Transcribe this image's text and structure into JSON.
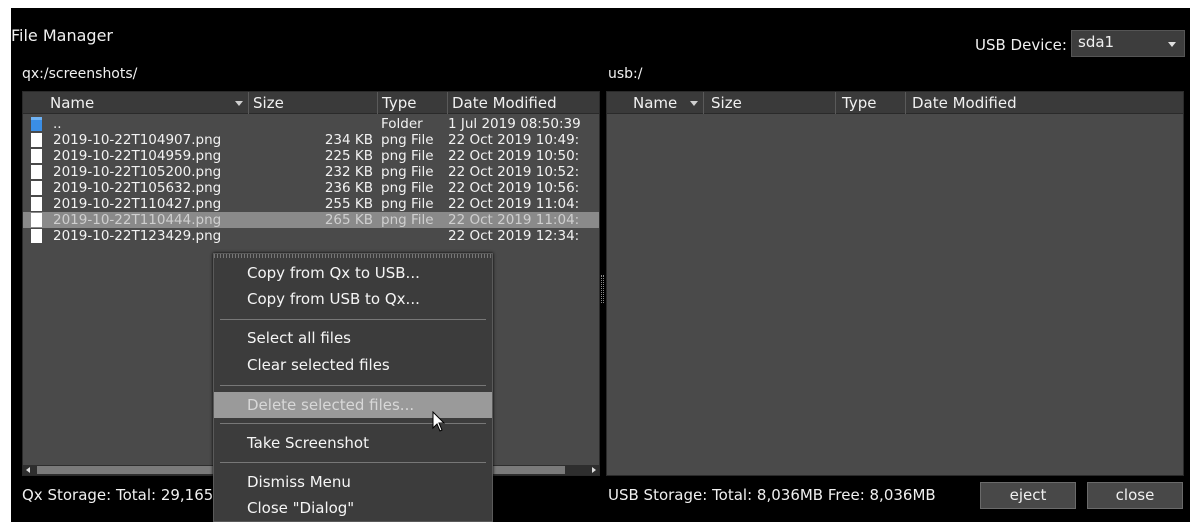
{
  "window": {
    "title": "File Manager",
    "usb_device_label": "USB Device:",
    "usb_device_value": "sda1"
  },
  "left_panel": {
    "path": "qx:/screenshots/",
    "columns": {
      "name": "Name",
      "size": "Size",
      "type": "Type",
      "date": "Date Modified"
    },
    "rows": [
      {
        "name": "..",
        "size": "",
        "type": "Folder",
        "date": "1 Jul 2019 08:50:39",
        "icon": "folder-icon",
        "selected": false
      },
      {
        "name": "2019-10-22T104907.png",
        "size": "234 KB",
        "type": "png File",
        "date": "22 Oct 2019 10:49:",
        "icon": "file-icon",
        "selected": false
      },
      {
        "name": "2019-10-22T104959.png",
        "size": "225 KB",
        "type": "png File",
        "date": "22 Oct 2019 10:50:",
        "icon": "file-icon",
        "selected": false
      },
      {
        "name": "2019-10-22T105200.png",
        "size": "232 KB",
        "type": "png File",
        "date": "22 Oct 2019 10:52:",
        "icon": "file-icon",
        "selected": false
      },
      {
        "name": "2019-10-22T105632.png",
        "size": "236 KB",
        "type": "png File",
        "date": "22 Oct 2019 10:56:",
        "icon": "file-icon",
        "selected": false
      },
      {
        "name": "2019-10-22T110427.png",
        "size": "255 KB",
        "type": "png File",
        "date": "22 Oct 2019 11:04:",
        "icon": "file-icon",
        "selected": false
      },
      {
        "name": "2019-10-22T110444.png",
        "size": "265 KB",
        "type": "png File",
        "date": "22 Oct 2019 11:04:",
        "icon": "file-icon",
        "selected": true
      },
      {
        "name": "2019-10-22T123429.png",
        "size": "",
        "type": "",
        "date": "22 Oct 2019 12:34:",
        "icon": "file-icon",
        "selected": false
      }
    ],
    "storage": "Qx Storage: Total: 29,165"
  },
  "right_panel": {
    "path": "usb:/",
    "columns": {
      "name": "Name",
      "size": "Size",
      "type": "Type",
      "date": "Date Modified"
    },
    "storage": "USB Storage: Total: 8,036MB Free: 8,036MB"
  },
  "buttons": {
    "eject": "eject",
    "close": "close"
  },
  "context_menu": {
    "copy_to_usb": "Copy from Qx to USB...",
    "copy_to_qx": "Copy from USB to Qx...",
    "select_all": "Select all files",
    "clear_selected": "Clear selected files",
    "delete_selected": "Delete selected files...",
    "take_screenshot": "Take Screenshot",
    "dismiss": "Dismiss Menu",
    "close_dialog": "Close \"Dialog\""
  },
  "colors": {
    "background": "#000000",
    "panel": "#4a4a4a",
    "selected_row": "#8a8a8a",
    "menu": "#3c3c3c",
    "menu_hover": "#9a9a9a",
    "folder": "#3a8ee6"
  }
}
